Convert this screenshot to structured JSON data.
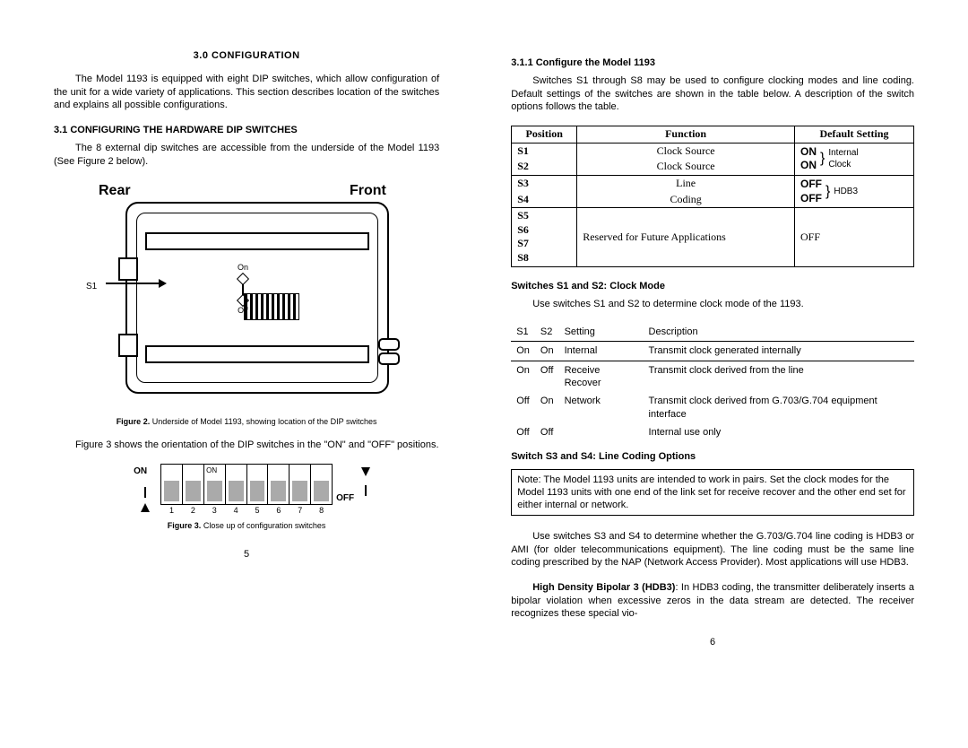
{
  "left": {
    "section_title": "3.0 CONFIGURATION",
    "intro": "The Model 1193 is equipped with eight DIP switches, which allow configuration of the unit for a wide variety of applications. This section describes location of the switches and explains all possible configurations.",
    "h31": "3.1 CONFIGURING THE HARDWARE DIP SWITCHES",
    "p31": "The 8 external dip switches are accessible from the underside of the Model 1193 (See Figure 2 below).",
    "rear": "Rear",
    "front": "Front",
    "s1": "S1",
    "on_mini": "On",
    "off_mini": "Off",
    "fig2_b": "Figure 2.",
    "fig2": "Underside of Model 1193, showing location of the DIP switches",
    "p32": "Figure 3 shows the orientation of the DIP switches in the \"ON\" and \"OFF\" positions.",
    "dip": {
      "on_out": "ON",
      "on_in": "ON",
      "off": "OFF",
      "nums": [
        "1",
        "2",
        "3",
        "4",
        "5",
        "6",
        "7",
        "8"
      ]
    },
    "fig3_b": "Figure 3.",
    "fig3": "Close up of configuration switches",
    "pagenum": "5"
  },
  "right": {
    "h311": "3.1.1 Configure the Model 1193",
    "p311": "Switches S1 through S8 may be used to configure clocking modes and line coding. Default settings of the switches are shown in the table below. A description of the switch options follows the table.",
    "table": {
      "head": {
        "pos": "Position",
        "fn": "Function",
        "def": "Default Setting"
      },
      "rows12": {
        "s1": "S1",
        "s2": "S2",
        "fn": "Clock Source",
        "d_on": "ON",
        "d_int": "Internal",
        "d_clk": "Clock"
      },
      "rows34": {
        "s3": "S3",
        "s4": "S4",
        "fn_line": "Line",
        "fn_code": "Coding",
        "d_off": "OFF",
        "d_hdb3": "HDB3"
      },
      "rows58": {
        "s5": "S5",
        "s6": "S6",
        "s7": "S7",
        "s8": "S8",
        "fn": "Reserved for Future Applications",
        "def": "OFF"
      }
    },
    "h_s12": "Switches S1 and S2: Clock Mode",
    "p_s12": "Use switches S1 and S2 to determine clock mode of the 1193.",
    "clk_head": {
      "s1": "S1",
      "s2": "S2",
      "set": "Setting",
      "desc": "Description"
    },
    "clk_rows": [
      {
        "s1": "On",
        "s2": "On",
        "set": "Internal",
        "desc": "Transmit clock generated internally"
      },
      {
        "s1": "On",
        "s2": "Off",
        "set": "Receive Recover",
        "desc": "Transmit clock derived from the line"
      },
      {
        "s1": "Off",
        "s2": "On",
        "set": "Network",
        "desc": "Transmit clock derived from G.703/G.704 equipment interface"
      },
      {
        "s1": "Off",
        "s2": "Off",
        "set": "",
        "desc": "Internal use only"
      }
    ],
    "h_s34": "Switch S3 and S4:  Line Coding Options",
    "note": "Note: The Model 1193 units are intended to work in pairs. Set the clock modes for the Model 1193 units with one end of the link set for receive recover and the other end set for either internal or network.",
    "p_s34": "Use switches S3 and S4 to determine whether the G.703/G.704 line coding is HDB3 or AMI (for older telecommunications equipment). The line coding must be the same line coding prescribed by the NAP (Network Access Provider).  Most applications will use HDB3.",
    "hdb3_b": "High Density Bipolar 3 (HDB3)",
    "hdb3": ":  In HDB3 coding, the transmitter deliberately inserts a bipolar violation when excessive zeros in the data stream are detected. The receiver recognizes these special vio-",
    "pagenum": "6"
  }
}
